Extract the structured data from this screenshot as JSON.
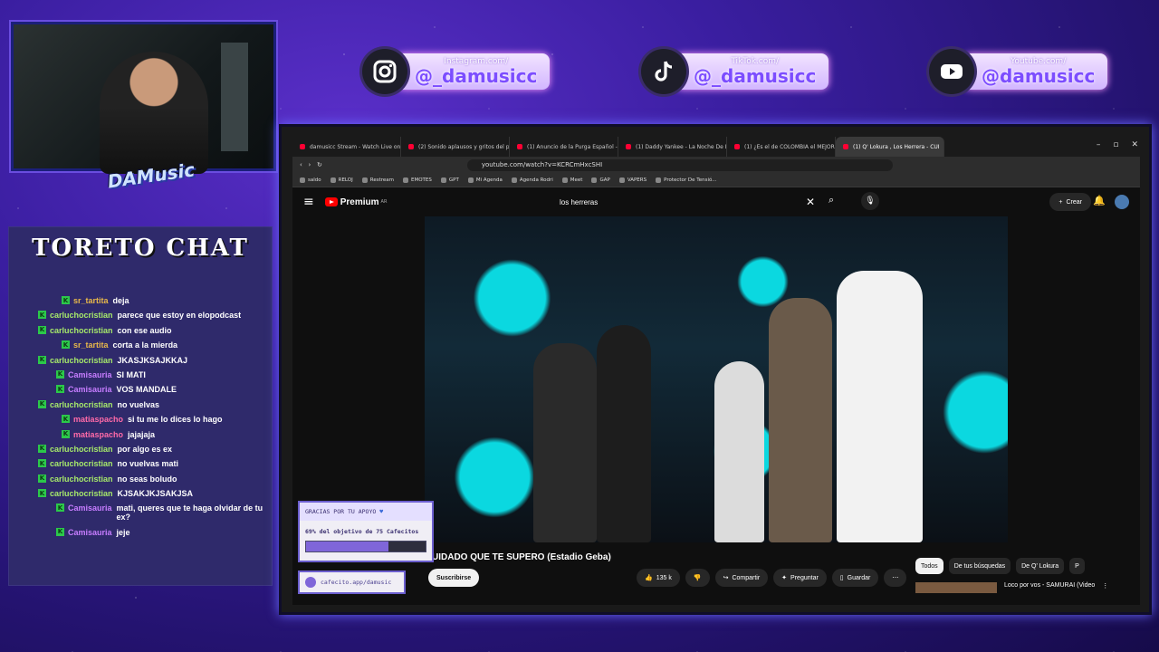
{
  "social": [
    {
      "platform_sub": "Instagram.com/",
      "handle": "@_damusicc",
      "icon": "instagram-icon"
    },
    {
      "platform_sub": "TikTok.com/",
      "handle": "@_damusicc",
      "icon": "tiktok-icon"
    },
    {
      "platform_sub": "Youtube.com/",
      "handle": "@damusicc",
      "icon": "youtube-icon"
    }
  ],
  "logo_text": "DAMusic",
  "chat": {
    "title": "TORETO CHAT",
    "messages": [
      {
        "user": "sr_tartita",
        "text": "deja",
        "color": "#e8b84a",
        "indent": 1
      },
      {
        "user": "carluchocristian",
        "text": "parece que estoy en elopodcast",
        "color": "#a6e86a",
        "indent": 0
      },
      {
        "user": "carluchocristian",
        "text": "con ese audio",
        "color": "#a6e86a",
        "indent": 0
      },
      {
        "user": "sr_tartita",
        "text": "corta a la mierda",
        "color": "#e8b84a",
        "indent": 1
      },
      {
        "user": "carluchocristian",
        "text": "JKASJKSAJKKAJ",
        "color": "#a6e86a",
        "indent": 0
      },
      {
        "user": "Camisauria",
        "text": "SI MATI",
        "color": "#c77dff",
        "indent": 2
      },
      {
        "user": "Camisauria",
        "text": "VOS MANDALE",
        "color": "#c77dff",
        "indent": 2
      },
      {
        "user": "carluchocristian",
        "text": "no vuelvas",
        "color": "#a6e86a",
        "indent": 0
      },
      {
        "user": "matiaspacho",
        "text": "si tu me lo dices lo hago",
        "color": "#ff6aa8",
        "indent": 1
      },
      {
        "user": "matiaspacho",
        "text": "jajajaja",
        "color": "#ff6aa8",
        "indent": 1
      },
      {
        "user": "carluchocristian",
        "text": "por algo es ex",
        "color": "#a6e86a",
        "indent": 0
      },
      {
        "user": "carluchocristian",
        "text": "no vuelvas mati",
        "color": "#a6e86a",
        "indent": 0
      },
      {
        "user": "carluchocristian",
        "text": "no seas boludo",
        "color": "#a6e86a",
        "indent": 0
      },
      {
        "user": "carluchocristian",
        "text": "KJSAKJKJSAKJSA",
        "color": "#a6e86a",
        "indent": 0
      },
      {
        "user": "Camisauria",
        "text": "mati, queres que te haga olvidar de tu ex?",
        "color": "#c77dff",
        "indent": 2
      },
      {
        "user": "Camisauria",
        "text": "jeje",
        "color": "#c77dff",
        "indent": 2
      }
    ]
  },
  "browser": {
    "tabs": [
      {
        "label": "damusicc Stream - Watch Live on",
        "active": false
      },
      {
        "label": "(2) Sonido aplausos y gritos del publ",
        "active": false
      },
      {
        "label": "(1) Anuncio de la Purga Español - Yo",
        "active": false
      },
      {
        "label": "(1) Daddy Yankee - La Noche De Los",
        "active": false
      },
      {
        "label": "(1) ¿Es el de COLOMBIA el MEJOR H",
        "active": false
      },
      {
        "label": "(1) Q' Lokura , Los Herrera - CUI",
        "active": true
      }
    ],
    "url": "youtube.com/watch?v=KCRCmHxcSHI",
    "bookmarks": [
      "saldo",
      "RELOJ",
      "Restream",
      "EMOTES",
      "GPT",
      "Mi Agenda",
      "Agenda Rodri",
      "Meet",
      "GAP",
      "VAPERS",
      "Protector De Tensió..."
    ]
  },
  "youtube": {
    "brand": "Premium",
    "region": "AR",
    "search_value": "los herreras",
    "create_label": "Crear",
    "notifications": "1",
    "video_title": "UIDADO QUE TE SUPERO (Estadio Geba)",
    "subscribe_label": "Suscribirse",
    "likes": "135 k",
    "share_label": "Compartir",
    "ask_label": "Preguntar",
    "save_label": "Guardar",
    "chips": [
      "Todos",
      "De tus búsquedas",
      "De Q' Lokura",
      "P"
    ],
    "related_title": "Loco por vos - SAMURAI (Video"
  },
  "donation": {
    "header": "GRACIAS POR TU APOYO",
    "progress_text": "69% del objetivo de 75 Cafecitos",
    "progress": 0.69,
    "link": "cafecito.app/damusic"
  }
}
